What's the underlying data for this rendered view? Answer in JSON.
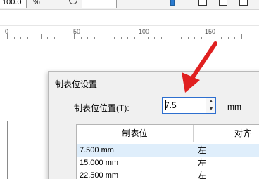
{
  "toolbar": {
    "zoom_value": "100.0",
    "zoom_unit": "%"
  },
  "ruler": {
    "labels": [
      "0",
      "50",
      "100",
      "150"
    ]
  },
  "dialog": {
    "title": "制表位设置",
    "position_label": "制表位位置(T):",
    "position_value": "7.5",
    "unit": "mm",
    "columns": [
      "制表位",
      "对齐"
    ],
    "rows": [
      {
        "position": "7.500 mm",
        "align": "左"
      },
      {
        "position": "15.000 mm",
        "align": "左"
      },
      {
        "position": "22.500 mm",
        "align": "左"
      }
    ]
  },
  "colors": {
    "accent": "#2e6fcf",
    "arrow": "#e02020",
    "selected_row": "#dfeefb"
  }
}
